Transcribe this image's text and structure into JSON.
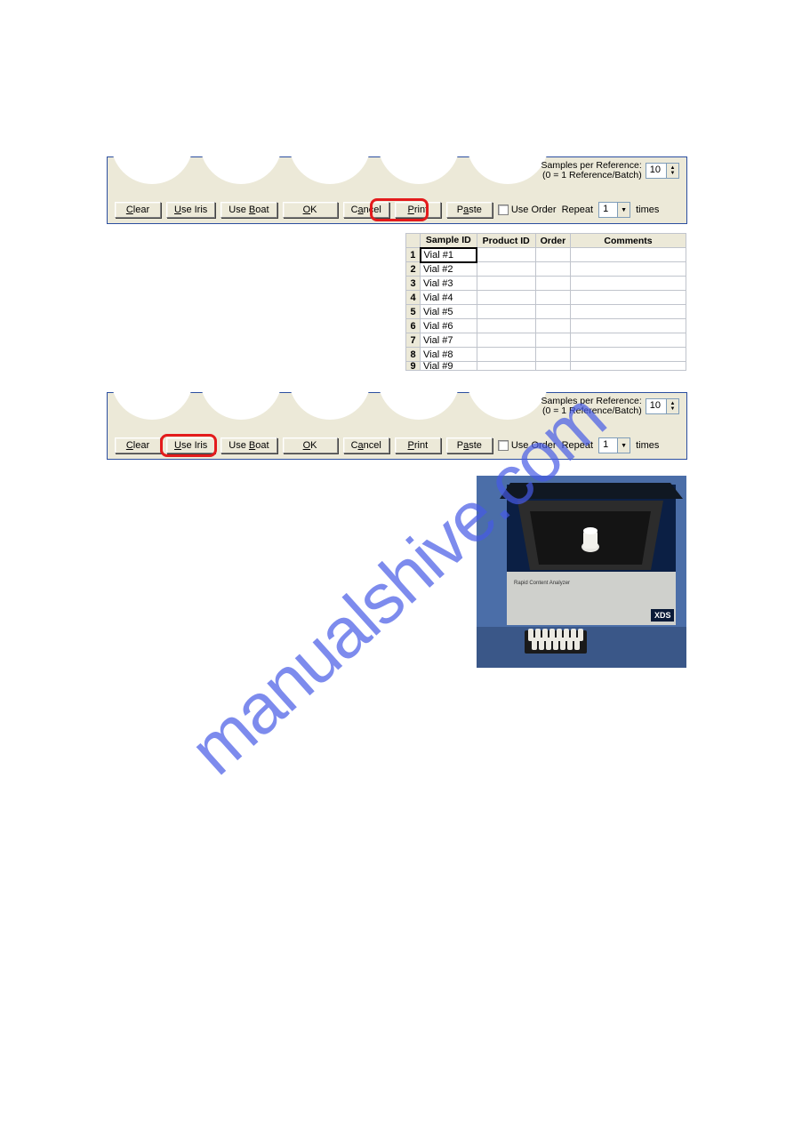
{
  "watermark": "manualshive.com",
  "bar1": {
    "spr_label_line1": "Samples per Reference:",
    "spr_label_line2": "(0 = 1 Reference/Batch)",
    "spr_value": "10",
    "buttons": {
      "clear": "Clear",
      "use_iris": "Use Iris",
      "use_boat": "Use Boat",
      "ok": "OK",
      "cancel": "Cancel",
      "print": "Print",
      "paste": "Paste"
    },
    "use_order": "Use Order",
    "repeat_label": "Repeat",
    "repeat_value": "1",
    "times": "times"
  },
  "table": {
    "headers": {
      "sample_id": "Sample ID",
      "product_id": "Product ID",
      "order": "Order",
      "comments": "Comments"
    },
    "rows": [
      {
        "n": "1",
        "sample_id": "Vial #1"
      },
      {
        "n": "2",
        "sample_id": "Vial #2"
      },
      {
        "n": "3",
        "sample_id": "Vial #3"
      },
      {
        "n": "4",
        "sample_id": "Vial #4"
      },
      {
        "n": "5",
        "sample_id": "Vial #5"
      },
      {
        "n": "6",
        "sample_id": "Vial #6"
      },
      {
        "n": "7",
        "sample_id": "Vial #7"
      },
      {
        "n": "8",
        "sample_id": "Vial #8"
      },
      {
        "n": "9",
        "sample_id": "Vial #9"
      }
    ]
  },
  "bar2": {
    "spr_label_line1": "Samples per Reference:",
    "spr_label_line2": "(0 = 1 Reference/Batch)",
    "spr_value": "10",
    "buttons": {
      "clear": "Clear",
      "use_iris": "Use Iris",
      "use_boat": "Use Boat",
      "ok": "OK",
      "cancel": "Cancel",
      "print": "Print",
      "paste": "Paste"
    },
    "use_order": "Use Order",
    "repeat_label": "Repeat",
    "repeat_value": "1",
    "times": "times"
  },
  "photo": {
    "device_label": "Rapid Content Analyzer",
    "brand": "XDS"
  }
}
